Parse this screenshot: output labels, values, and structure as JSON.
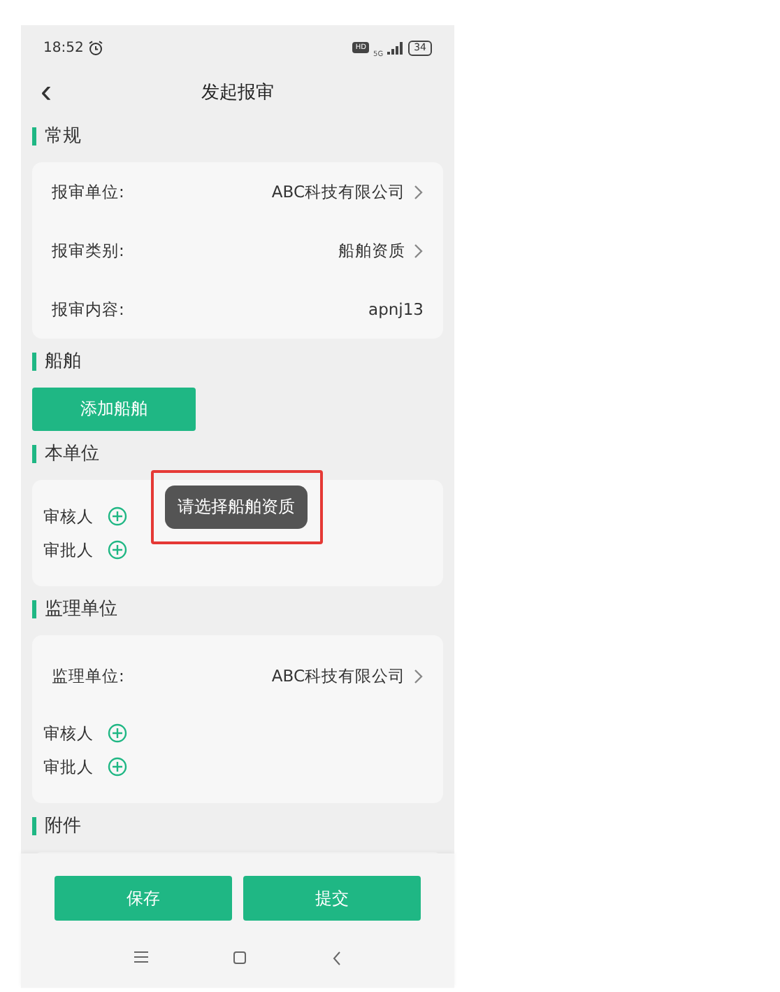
{
  "status_bar": {
    "time": "18:52",
    "hd": "HD",
    "network": "5G",
    "battery": "34"
  },
  "header": {
    "back": "‹",
    "title": "发起报审"
  },
  "sections": [
    {
      "kind": "rows",
      "title": "常规",
      "rows": [
        {
          "kind": "select",
          "label": "报审单位:",
          "value": "ABC科技有限公司"
        },
        {
          "kind": "select",
          "label": "报审类别:",
          "value": "船舶资质"
        },
        {
          "kind": "text",
          "label": "报审内容:",
          "value": "apnj13"
        }
      ]
    },
    {
      "kind": "button",
      "title": "船舶",
      "button": "添加船舶"
    },
    {
      "kind": "rows",
      "title": "本单位",
      "rows": [
        {
          "kind": "person",
          "label": "审核人"
        },
        {
          "kind": "person",
          "label": "审批人"
        }
      ]
    },
    {
      "kind": "rows",
      "title": "监理单位",
      "rows": [
        {
          "kind": "select",
          "label": "监理单位:",
          "value": "ABC科技有限公司"
        },
        {
          "kind": "person",
          "label": "审核人"
        },
        {
          "kind": "person",
          "label": "审批人"
        }
      ]
    },
    {
      "kind": "partial",
      "title": "附件"
    }
  ],
  "toast": {
    "text": "请选择船舶资质",
    "highlighted": true
  },
  "actions": [
    "保存",
    "提交"
  ]
}
